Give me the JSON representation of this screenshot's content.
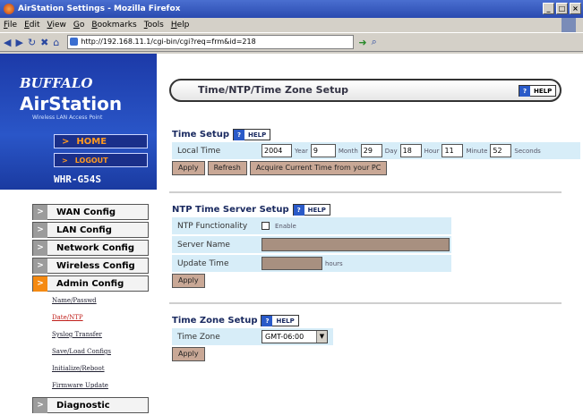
{
  "window": {
    "title": "AirStation Settings - Mozilla Firefox"
  },
  "menubar": [
    "File",
    "Edit",
    "View",
    "Go",
    "Bookmarks",
    "Tools",
    "Help"
  ],
  "address": {
    "url": "http://192.168.11.1/cgi-bin/cgi?req=frm&id=218"
  },
  "brand": {
    "logo": "BUFFALO",
    "product": "AirStation",
    "tagline": "Wireless LAN Access Point",
    "home": "HOME",
    "logout": "LOGOUT",
    "model": "WHR-G54S"
  },
  "menu": {
    "items": [
      {
        "label": "WAN Config"
      },
      {
        "label": "LAN Config"
      },
      {
        "label": "Network Config"
      },
      {
        "label": "Wireless Config"
      },
      {
        "label": "Admin Config"
      }
    ],
    "subitems": [
      "Name/Passwd",
      "Date/NTP",
      "Syslog Transfer",
      "Save/Load Configs",
      "Initialize/Reboot",
      "Firmware Update"
    ],
    "diagnostic": "Diagnostic"
  },
  "page": {
    "title": "Time/NTP/Time Zone Setup",
    "help": "HELP"
  },
  "time_setup": {
    "heading": "Time Setup",
    "help": "HELP",
    "label": "Local Time",
    "year": "2004",
    "year_unit": "Year",
    "month": "9",
    "month_unit": "Month",
    "day": "29",
    "day_unit": "Day",
    "hour": "18",
    "hour_unit": "Hour",
    "minute": "11",
    "minute_unit": "Minute",
    "second": "52",
    "second_unit": "Seconds",
    "apply": "Apply",
    "refresh": "Refresh",
    "acquire": "Acquire Current Time from your PC"
  },
  "ntp": {
    "heading": "NTP Time Server Setup",
    "help": "HELP",
    "functionality_label": "NTP Functionality",
    "enable_label": "Enable",
    "server_label": "Server Name",
    "server_value": "",
    "update_label": "Update Time",
    "update_value": "",
    "update_unit": "hours",
    "apply": "Apply"
  },
  "timezone": {
    "heading": "Time Zone Setup",
    "help": "HELP",
    "label": "Time Zone",
    "value": "GMT-06:00",
    "apply": "Apply"
  }
}
